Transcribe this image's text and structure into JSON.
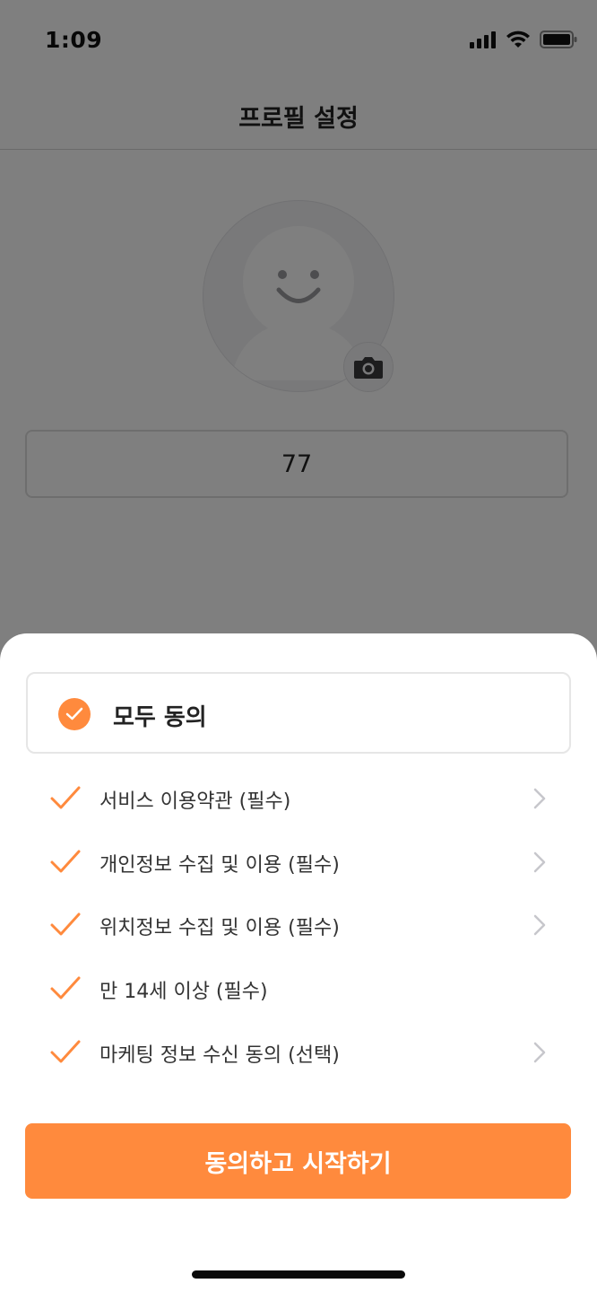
{
  "status_bar": {
    "time": "1:09",
    "icons": [
      "cellular-signal-icon",
      "wifi-icon",
      "battery-icon"
    ]
  },
  "header": {
    "title": "프로필 설정"
  },
  "profile": {
    "avatar_icon": "default-avatar-smiley-icon",
    "camera_icon": "camera-icon",
    "nickname_value": "77"
  },
  "agreement_sheet": {
    "agree_all": {
      "label": "모두 동의",
      "checked": true
    },
    "terms": [
      {
        "label": "서비스 이용약관 (필수)",
        "checked": true,
        "has_detail": true
      },
      {
        "label": "개인정보 수집 및 이용 (필수)",
        "checked": true,
        "has_detail": true
      },
      {
        "label": "위치정보 수집 및 이용 (필수)",
        "checked": true,
        "has_detail": true
      },
      {
        "label": "만 14세 이상 (필수)",
        "checked": true,
        "has_detail": false
      },
      {
        "label": "마케팅 정보 수신 동의 (선택)",
        "checked": true,
        "has_detail": true
      }
    ],
    "start_button_label": "동의하고 시작하기"
  },
  "colors": {
    "accent": "#ff8a3d",
    "overlay": "rgba(0,0,0,0.5)",
    "chevron": "#c7c7cc"
  }
}
